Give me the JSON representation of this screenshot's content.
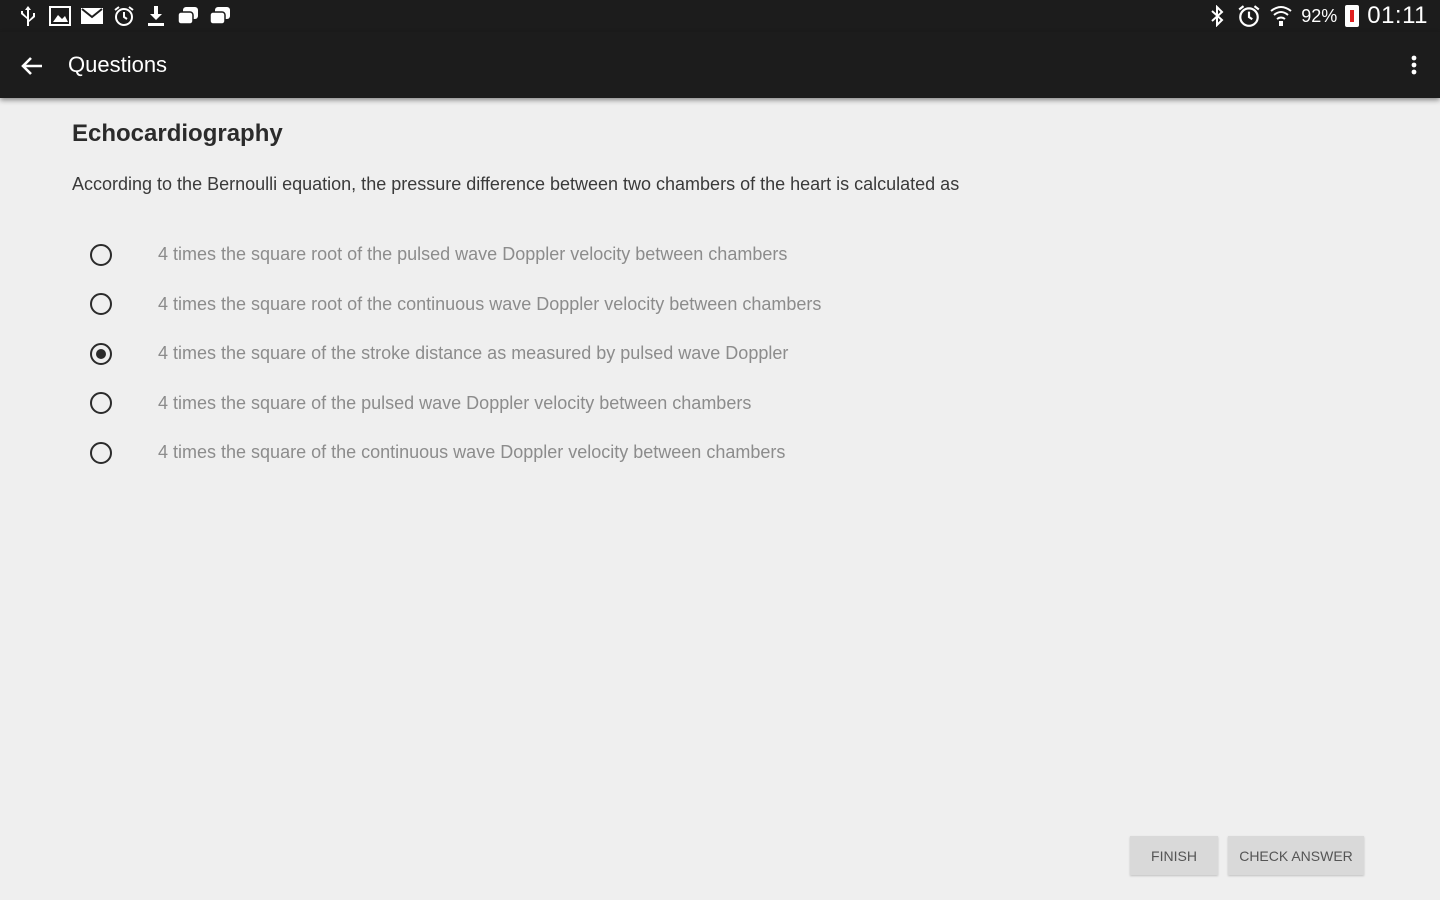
{
  "status_bar": {
    "left_icons": [
      "usb-icon",
      "gallery-icon",
      "mail-icon",
      "alarm-icon",
      "download-icon",
      "notification-icon",
      "notification-icon"
    ],
    "right_icons": [
      "bluetooth-icon",
      "alarm-icon",
      "wifi-icon"
    ],
    "battery_percent": "92%",
    "time": "01:11"
  },
  "app_bar": {
    "title": "Questions",
    "back_icon": "arrow-back-icon",
    "menu_icon": "overflow-menu-icon"
  },
  "quiz": {
    "topic": "Echocardiography",
    "question": "According to the Bernoulli equation, the pressure difference between two chambers of the heart is calculated as",
    "options": [
      {
        "label": "4 times the square root of the pulsed wave Doppler velocity between chambers",
        "selected": false
      },
      {
        "label": "4 times the square root of the continuous wave Doppler velocity between chambers",
        "selected": false
      },
      {
        "label": "4 times the square of the stroke distance as measured by pulsed wave Doppler",
        "selected": true
      },
      {
        "label": "4 times the square of the pulsed wave Doppler velocity between chambers",
        "selected": false
      },
      {
        "label": "4 times the square of the continuous wave Doppler velocity between chambers",
        "selected": false
      }
    ]
  },
  "buttons": {
    "finish_label": "FINISH",
    "check_answer_label": "CHECK ANSWER"
  },
  "colors": {
    "app_bar": "#1c1c1c",
    "background": "#efefef",
    "option_text": "#8c8c8c",
    "button_bg": "#d9d9d9",
    "battery_low": "#e02020"
  }
}
